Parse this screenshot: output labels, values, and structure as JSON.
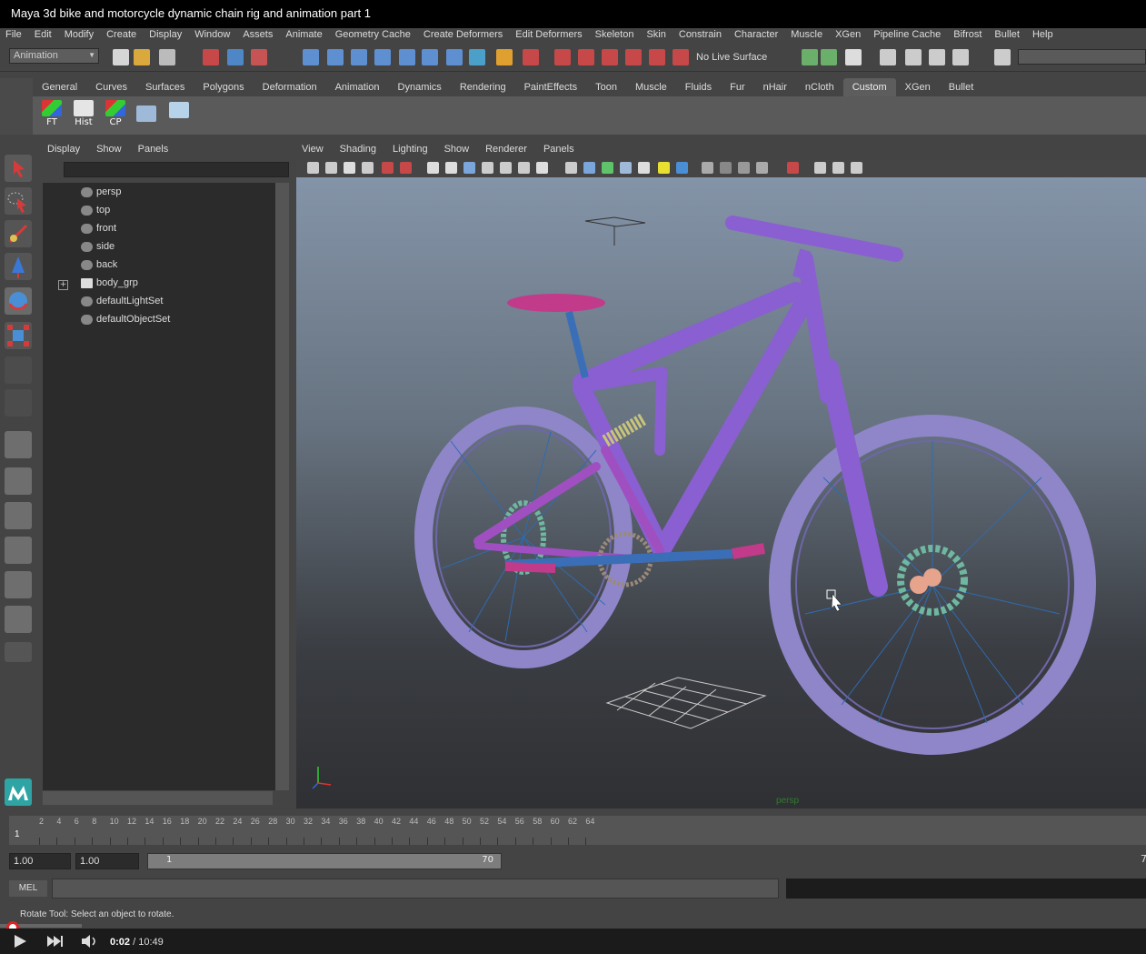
{
  "window": {
    "title": "Maya 3d bike and motorcycle dynamic chain rig and animation part 1"
  },
  "menu": [
    "File",
    "Edit",
    "Modify",
    "Create",
    "Display",
    "Window",
    "Assets",
    "Animate",
    "Geometry Cache",
    "Create Deformers",
    "Edit Deformers",
    "Skeleton",
    "Skin",
    "Constrain",
    "Character",
    "Muscle",
    "XGen",
    "Pipeline Cache",
    "Bifrost",
    "Bullet",
    "Help"
  ],
  "status_line": {
    "mode": "Animation",
    "live_surface": "No Live Surface"
  },
  "shelf": {
    "tabs": [
      "General",
      "Curves",
      "Surfaces",
      "Polygons",
      "Deformation",
      "Animation",
      "Dynamics",
      "Rendering",
      "PaintEffects",
      "Toon",
      "Muscle",
      "Fluids",
      "Fur",
      "nHair",
      "nCloth",
      "Custom",
      "XGen",
      "Bullet"
    ],
    "active_tab": "Custom",
    "buttons": [
      "FT",
      "Hist",
      "CP"
    ]
  },
  "outliner": {
    "menu": [
      "Display",
      "Show",
      "Panels"
    ],
    "items": [
      "persp",
      "top",
      "front",
      "side",
      "back",
      "body_grp",
      "defaultLightSet",
      "defaultObjectSet"
    ]
  },
  "viewport": {
    "menu": [
      "View",
      "Shading",
      "Lighting",
      "Show",
      "Renderer",
      "Panels"
    ],
    "camera": "persp"
  },
  "timeline": {
    "ticks": [
      "2",
      "4",
      "6",
      "8",
      "10",
      "12",
      "14",
      "16",
      "18",
      "20",
      "22",
      "24",
      "26",
      "28",
      "30",
      "32",
      "34",
      "36",
      "38",
      "40",
      "42",
      "44",
      "46",
      "48",
      "50",
      "52",
      "54",
      "56",
      "58",
      "60",
      "62",
      "64"
    ],
    "current_frame": "1",
    "start_time": "1.00",
    "playback_start": "1.00",
    "range_start": "1",
    "range_end": "70",
    "end_label": "7"
  },
  "command_line": {
    "label": "MEL"
  },
  "help_line": "Rotate Tool: Select an object to rotate.",
  "player": {
    "current": "0:02",
    "separator": " / ",
    "duration": "10:49",
    "progress": 0.003
  },
  "colors": {
    "bike_frame": "#8a5fd1",
    "tire": "#8f86c9",
    "viewport_top": "#8494a8",
    "viewport_bottom": "#2f3033",
    "accent_custom_tab": "#5d5d5d"
  }
}
